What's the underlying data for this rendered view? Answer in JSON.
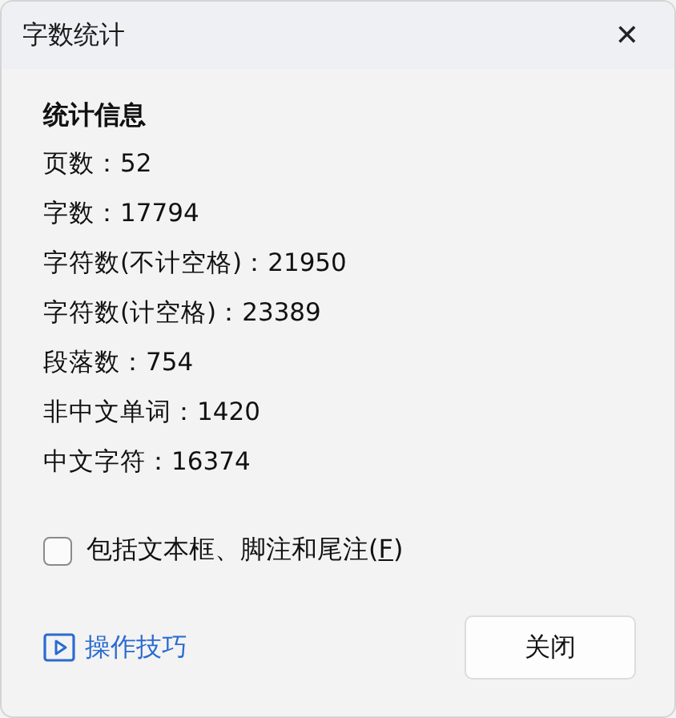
{
  "window": {
    "title": "字数统计",
    "close_glyph": "✕"
  },
  "statistics": {
    "heading": "统计信息",
    "rows": [
      "页数：52",
      "字数：17794",
      "字符数(不计空格)：21950",
      "字符数(计空格)：23389",
      "段落数：754",
      "非中文单词：1420",
      "中文字符：16374"
    ]
  },
  "include_option": {
    "label_before": "包括文本框、脚注和尾注(",
    "access_key": "F",
    "label_after": ")",
    "checked": false
  },
  "tips_link": {
    "label": "操作技巧"
  },
  "buttons": [
    {
      "label": "关闭"
    }
  ]
}
